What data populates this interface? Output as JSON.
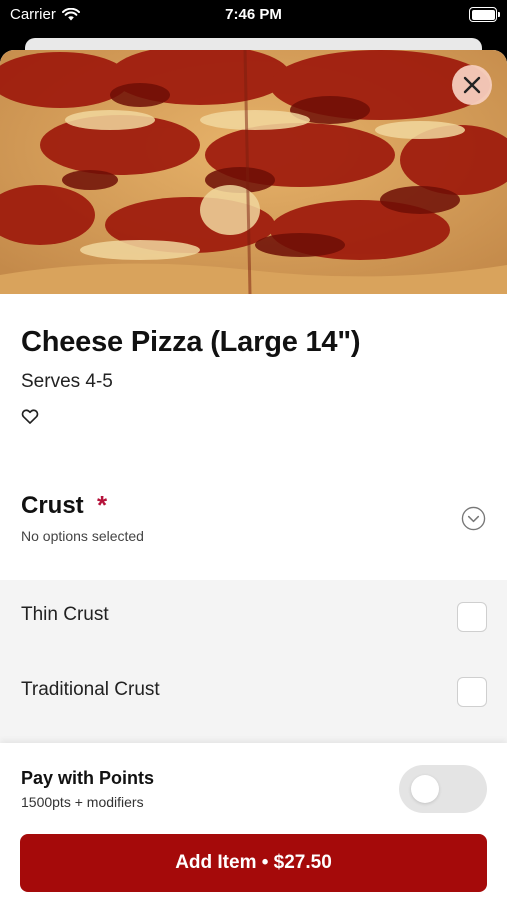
{
  "status_bar": {
    "carrier": "Carrier",
    "time": "7:46 PM",
    "icons": [
      "wifi-icon",
      "battery-icon"
    ]
  },
  "item": {
    "title": "Cheese Pizza (Large 14\")",
    "subtitle": "Serves 4-5",
    "image_icon": "pizza-photo",
    "favorite_icon": "heart-outline-icon",
    "close_icon": "close-icon"
  },
  "modifier_group": {
    "title": "Crust",
    "required_mark": "*",
    "status": "No options selected",
    "expand_icon": "chevron-down-circle-icon",
    "options": [
      {
        "label": "Thin Crust",
        "checked": false
      },
      {
        "label": "Traditional Crust",
        "checked": false
      }
    ]
  },
  "footer": {
    "points_title": "Pay with Points",
    "points_subtitle": "1500pts + modifiers",
    "points_toggle_on": false,
    "add_button": "Add Item • $27.50"
  },
  "colors": {
    "accent": "#a50a0a",
    "required": "#b5123a",
    "option_bg": "#f4f4f4"
  }
}
